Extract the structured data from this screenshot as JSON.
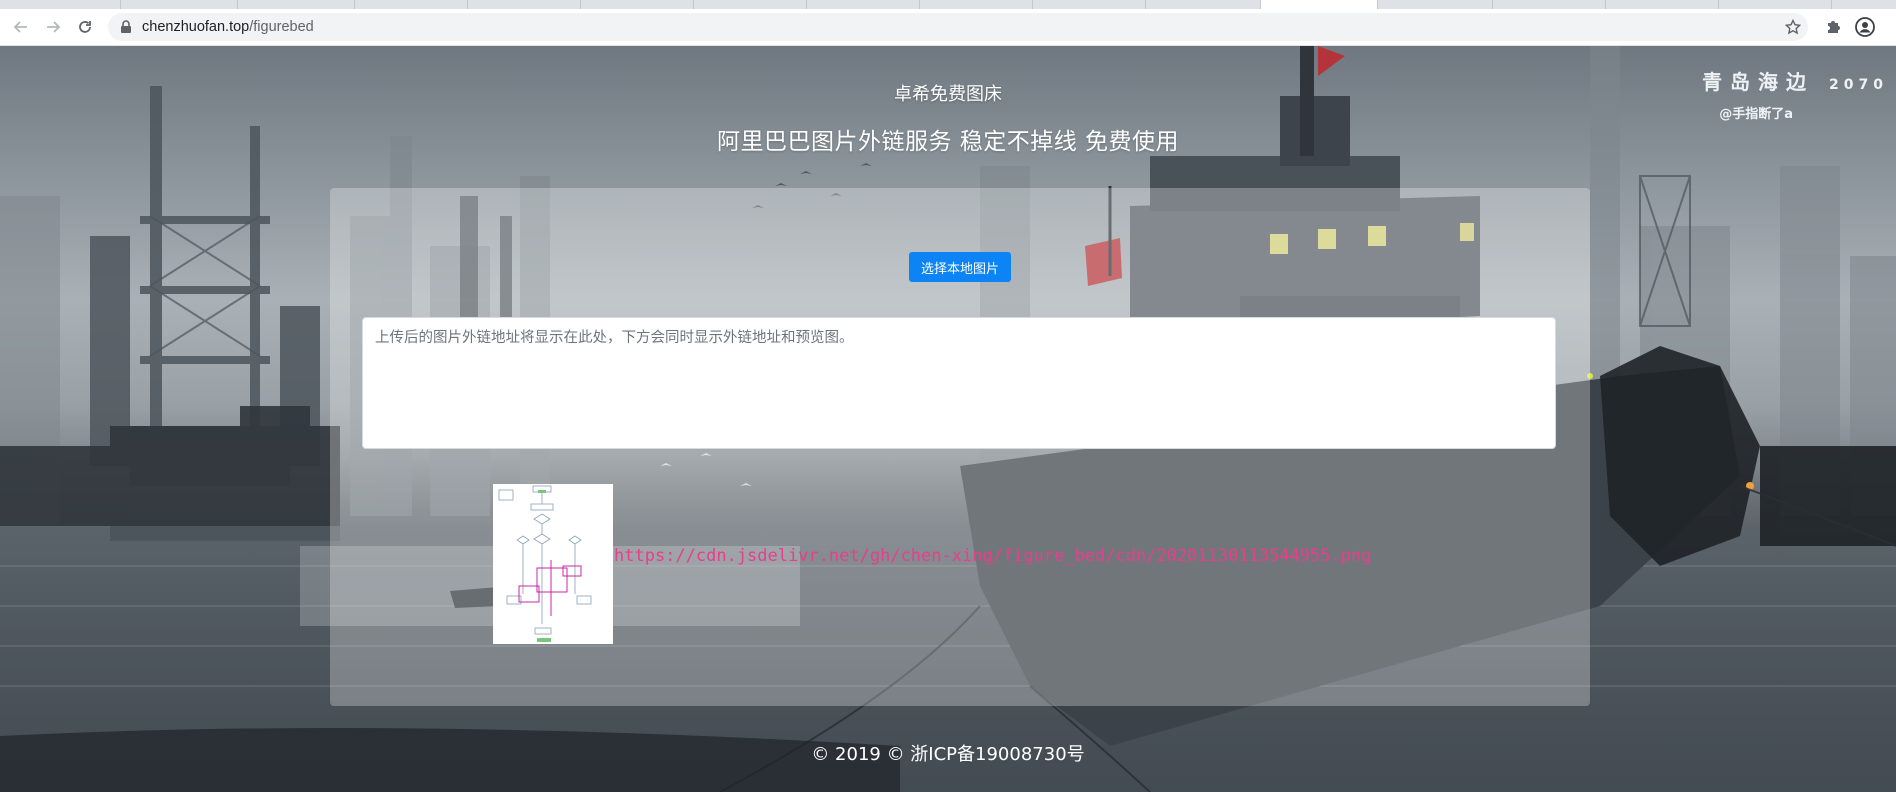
{
  "browser": {
    "url_host": "chenzhuofan.top",
    "url_path": "/figurebed"
  },
  "colors": {
    "primary_button": "#0d84f5",
    "link_pink": "#e83e8c",
    "chrome_bg": "#ffffff",
    "tabstrip_bg": "#dee1e6"
  },
  "icons": [
    "back-arrow-icon",
    "forward-arrow-icon",
    "reload-icon",
    "lock-icon",
    "star-icon",
    "extensions-puzzle-icon",
    "account-icon"
  ],
  "background_sign": {
    "title": "青岛海边",
    "year": "2070",
    "author": "@手指断了a"
  },
  "header": {
    "title": "卓希免费图床",
    "subtitle": "阿里巴巴图片外链服务 稳定不掉线 免费使用"
  },
  "upload": {
    "button_label": "选择本地图片",
    "output_placeholder": "上传后的图片外链地址将显示在此处，下方会同时显示外链地址和预览图。",
    "output_value": ""
  },
  "preview": {
    "link": "https://cdn.jsdelivr.net/gh/chen-xing/figure_bed/cdn/20201130113544955.png"
  },
  "footer": {
    "text": "© 2019 © 浙ICP备19008730号"
  }
}
